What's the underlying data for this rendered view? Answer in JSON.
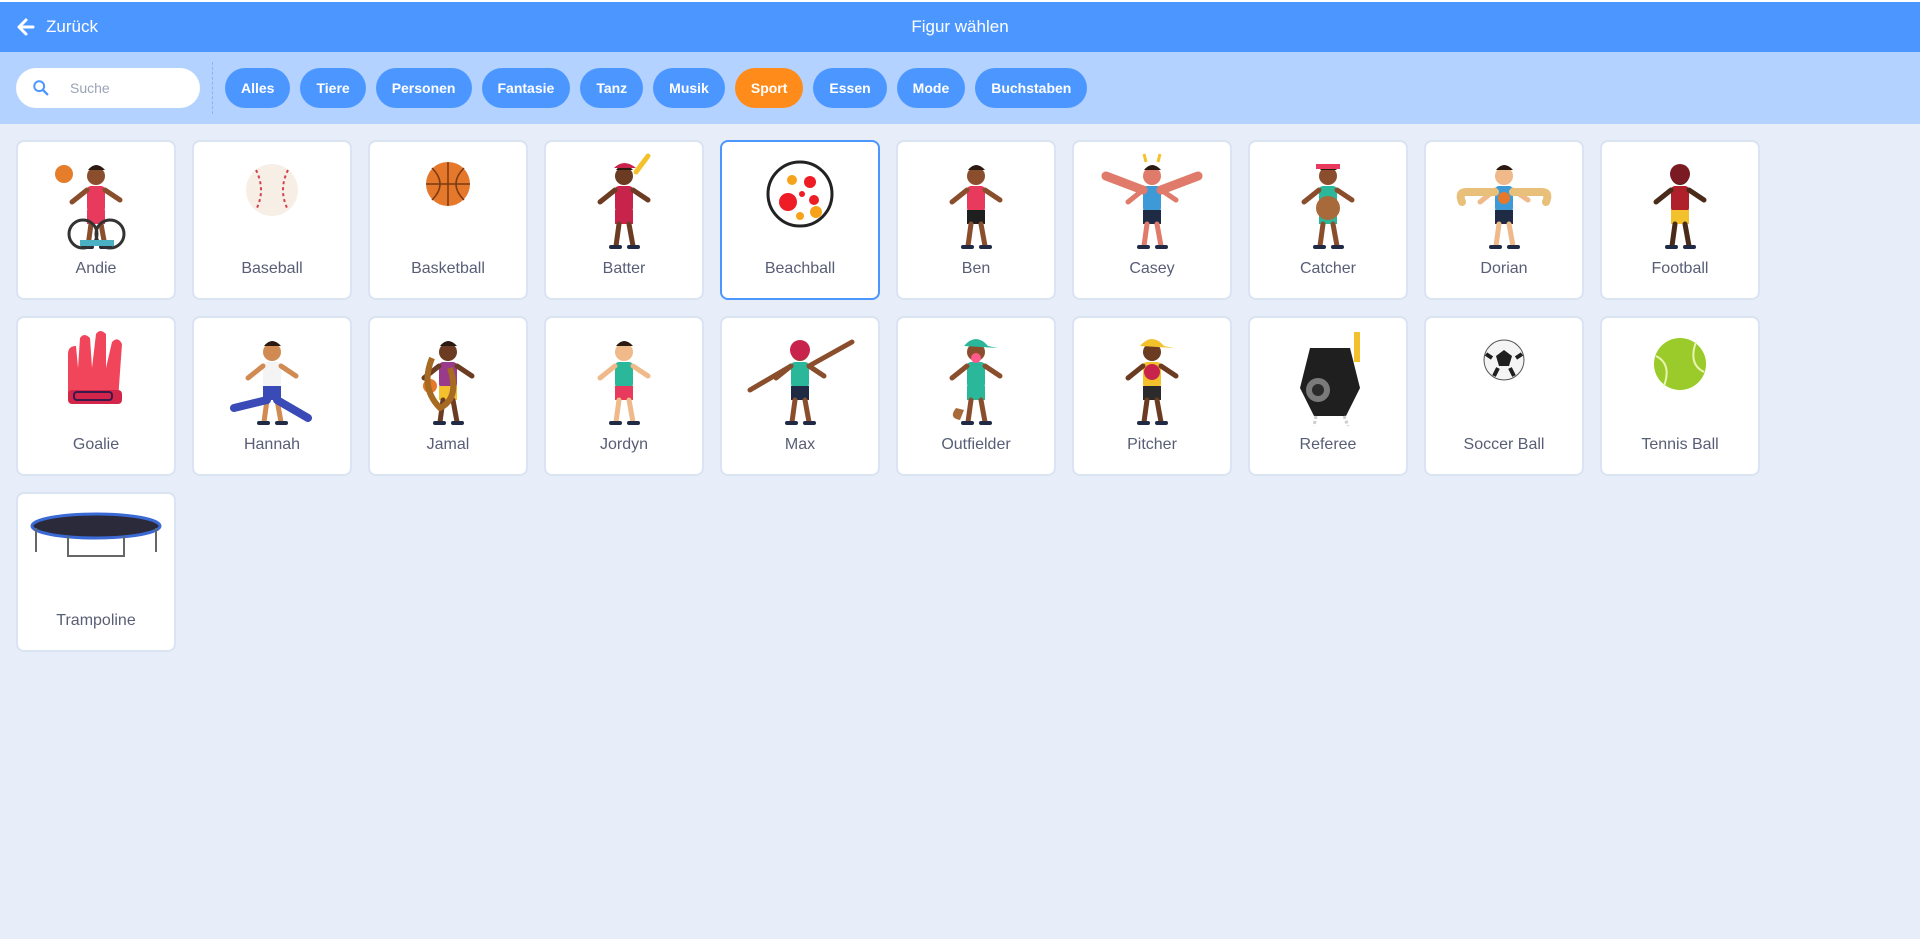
{
  "header": {
    "back_label": "Zurück",
    "title": "Figur wählen"
  },
  "search": {
    "placeholder": "Suche",
    "value": ""
  },
  "tags": [
    {
      "label": "Alles",
      "active": false
    },
    {
      "label": "Tiere",
      "active": false
    },
    {
      "label": "Personen",
      "active": false
    },
    {
      "label": "Fantasie",
      "active": false
    },
    {
      "label": "Tanz",
      "active": false
    },
    {
      "label": "Musik",
      "active": false
    },
    {
      "label": "Sport",
      "active": true
    },
    {
      "label": "Essen",
      "active": false
    },
    {
      "label": "Mode",
      "active": false
    },
    {
      "label": "Buchstaben",
      "active": false
    }
  ],
  "colors": {
    "header": "#4c97ff",
    "filterbar": "#b3d2ff",
    "tag": "#4c97ff",
    "tag_active": "#ff8c1a",
    "background": "#e8eef9"
  },
  "sprites": [
    {
      "name": "Andie",
      "art": "wheelchair-player",
      "selected": false
    },
    {
      "name": "Baseball",
      "art": "baseball",
      "selected": false
    },
    {
      "name": "Basketball",
      "art": "basketball",
      "selected": false
    },
    {
      "name": "Batter",
      "art": "batter",
      "selected": false
    },
    {
      "name": "Beachball",
      "art": "beachball",
      "selected": true
    },
    {
      "name": "Ben",
      "art": "runner",
      "selected": false
    },
    {
      "name": "Casey",
      "art": "wide-person",
      "selected": false
    },
    {
      "name": "Catcher",
      "art": "catcher",
      "selected": false
    },
    {
      "name": "Dorian",
      "art": "person-with-ball",
      "selected": false
    },
    {
      "name": "Football",
      "art": "football-player",
      "selected": false
    },
    {
      "name": "Goalie",
      "art": "goalie-glove",
      "selected": false
    },
    {
      "name": "Hannah",
      "art": "hurdler",
      "selected": false
    },
    {
      "name": "Jamal",
      "art": "dribbler",
      "selected": false
    },
    {
      "name": "Jordyn",
      "art": "kicker",
      "selected": false
    },
    {
      "name": "Max",
      "art": "arms-spread",
      "selected": false
    },
    {
      "name": "Outfielder",
      "art": "outfielder",
      "selected": false
    },
    {
      "name": "Pitcher",
      "art": "pitcher",
      "selected": false
    },
    {
      "name": "Referee",
      "art": "whistle",
      "selected": false
    },
    {
      "name": "Soccer Ball",
      "art": "soccer-ball",
      "selected": false
    },
    {
      "name": "Tennis Ball",
      "art": "tennis-ball",
      "selected": false
    },
    {
      "name": "Trampoline",
      "art": "trampoline",
      "selected": false
    }
  ]
}
